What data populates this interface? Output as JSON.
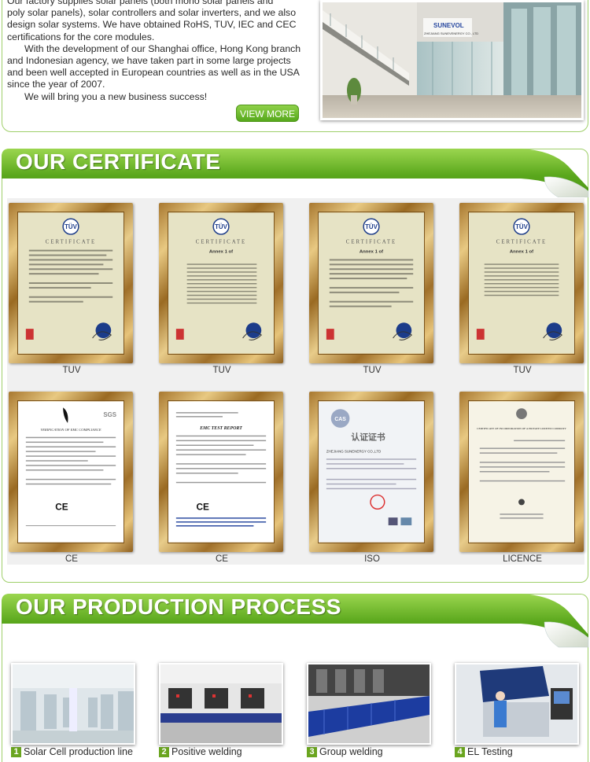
{
  "about": {
    "lines": [
      "Our factory supplies solar panels (both mono solar panels and",
      "poly solar panels), solar controllers and solar inverters, and we also",
      "design solar systems. We have obtained RoHS, TUV, IEC and CEC",
      "certifications for the core modules."
    ],
    "para2": [
      "With the development of our Shanghai office, Hong Kong branch",
      "and Indonesian agency, we have taken part in some large projects",
      "and been well accepted in European countries as well as in the USA",
      "since the year of 2007."
    ],
    "para3": "We will bring you a new business success!",
    "view_more_label": "VIEW MORE",
    "sign_text": "SUNEVOL",
    "sign_sub": "ZHEJIANG SUNEVENERGY CO., LTD"
  },
  "certificate": {
    "title": "OUR CERTIFICATE",
    "items": [
      {
        "label": "TUV"
      },
      {
        "label": "TUV"
      },
      {
        "label": "TUV"
      },
      {
        "label": "TUV"
      },
      {
        "label": "CE"
      },
      {
        "label": "CE"
      },
      {
        "label": "ISO"
      },
      {
        "label": "LICENCE"
      }
    ],
    "doc_texts": {
      "tuv_head": "CERTIFICATE",
      "annex": "Annex 1 of",
      "tuv_mark": "TÜV",
      "emc_title": "VERIFICATION OF EMC COMPLIANCE",
      "emc_report": "EMC TEST REPORT",
      "iso_title": "认证证书",
      "iso_company": "ZHEJIANG SUNENERGY CO.,LTD",
      "licence_title": "CERTIFICATE OF INCORPORATION OF A PRIVATE LIMITED COMPANY",
      "ce_mark": "CE",
      "sgs": "SGS",
      "cas": "CAS"
    }
  },
  "production": {
    "title": "OUR PRODUCTION PROCESS",
    "items": [
      {
        "num": "1",
        "label": "Solar Cell production line"
      },
      {
        "num": "2",
        "label": "Positive welding"
      },
      {
        "num": "3",
        "label": "Group welding"
      },
      {
        "num": "4",
        "label": "EL Testing"
      }
    ]
  },
  "colors": {
    "banner_green": "#5aa71c",
    "banner_light": "#9bd64f",
    "border_green": "#9fcf6a",
    "gold": "#c99a48"
  }
}
